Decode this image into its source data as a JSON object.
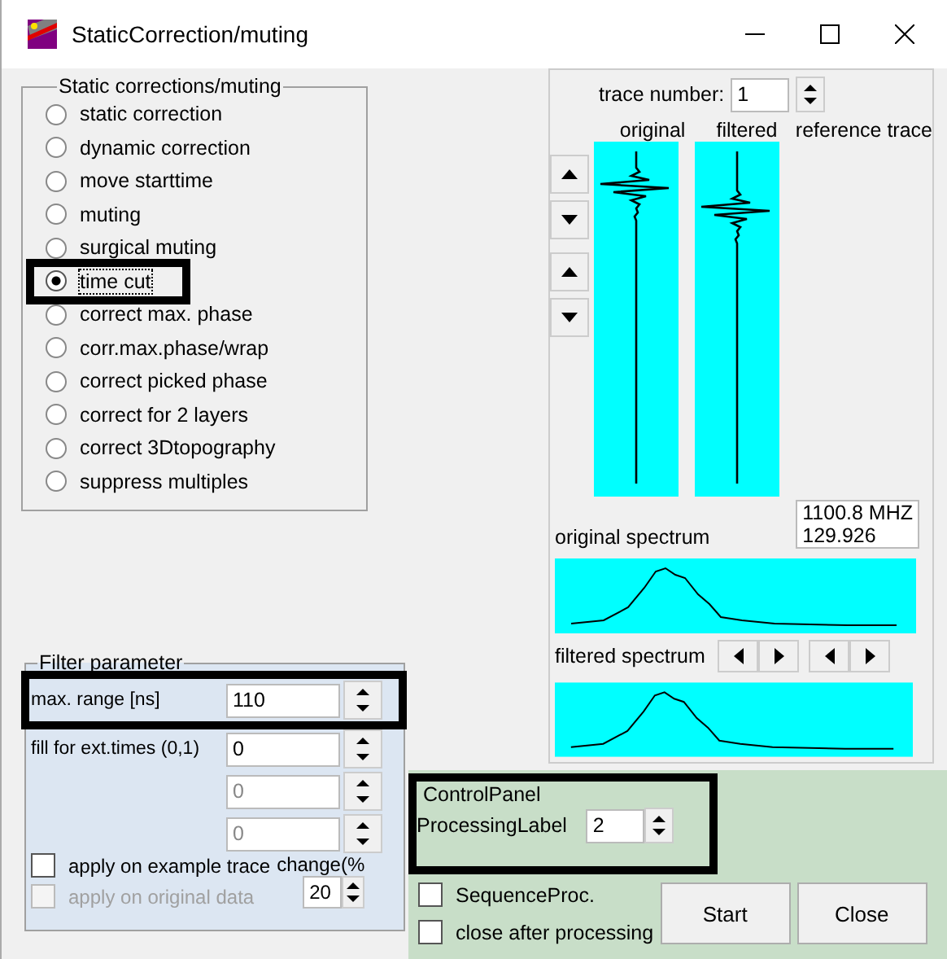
{
  "window": {
    "title": "StaticCorrection/muting"
  },
  "corrections": {
    "title": "Static corrections/muting",
    "options": [
      {
        "label": "static correction",
        "selected": false,
        "highlighted": false
      },
      {
        "label": "dynamic correction",
        "selected": false,
        "highlighted": false
      },
      {
        "label": "move starttime",
        "selected": false,
        "highlighted": false
      },
      {
        "label": "muting",
        "selected": false,
        "highlighted": false
      },
      {
        "label": "surgical muting",
        "selected": false,
        "highlighted": false
      },
      {
        "label": "time cut",
        "selected": true,
        "highlighted": true
      },
      {
        "label": "correct max. phase",
        "selected": false,
        "highlighted": false
      },
      {
        "label": "corr.max.phase/wrap",
        "selected": false,
        "highlighted": false
      },
      {
        "label": "correct picked phase",
        "selected": false,
        "highlighted": false
      },
      {
        "label": "correct for 2 layers",
        "selected": false,
        "highlighted": false
      },
      {
        "label": "correct 3Dtopography",
        "selected": false,
        "highlighted": false
      },
      {
        "label": "suppress multiples",
        "selected": false,
        "highlighted": false
      }
    ]
  },
  "trace_panel": {
    "trace_number_label": "trace number:",
    "trace_number": "1",
    "columns": [
      "original",
      "filtered",
      "reference trace"
    ],
    "frequency": [
      "1100.8 MHZ",
      "129.926"
    ],
    "original_spectrum_label": "original spectrum",
    "filtered_spectrum_label": "filtered spectrum"
  },
  "filter": {
    "title": "Filter parameter",
    "fields": [
      {
        "label": "max. range [ns]",
        "value": "110",
        "disabled": false,
        "highlighted": true
      },
      {
        "label": "fill for ext.times (0,1)",
        "value": "0",
        "disabled": false,
        "highlighted": false
      },
      {
        "value": "0",
        "disabled": true,
        "highlighted": false
      },
      {
        "value": "0",
        "disabled": true,
        "highlighted": false
      }
    ],
    "checkboxes": [
      {
        "label": "apply on example trace",
        "checked": false,
        "disabled": false
      },
      {
        "label": "apply on original data",
        "checked": false,
        "disabled": true
      }
    ],
    "change_label": "change(%",
    "change_value": "20"
  },
  "control_panel": {
    "title": "ControlPanel",
    "processing_label": "ProcessingLabel",
    "processing_value": "2",
    "highlighted": true,
    "checkboxes": [
      {
        "label": "SequenceProc.",
        "checked": false
      },
      {
        "label": "close after processing",
        "checked": false
      }
    ],
    "buttons": [
      "Start",
      "Close"
    ]
  }
}
